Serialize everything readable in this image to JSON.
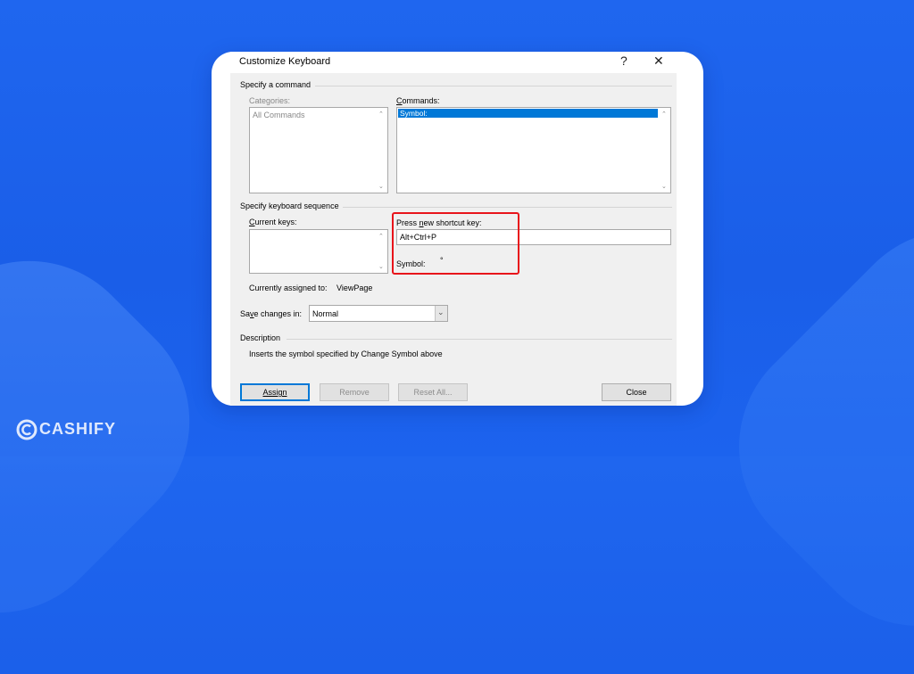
{
  "dialog": {
    "title": "Customize Keyboard",
    "help": "?",
    "close": "✕"
  },
  "specify_command": {
    "legend": "Specify a command",
    "categories_label": "Categories:",
    "categories": [
      "All Commands"
    ],
    "commands_label": "Commands:",
    "commands": [
      "Symbol:"
    ],
    "selected_command": "Symbol:"
  },
  "keyboard_sequence": {
    "legend": "Specify keyboard sequence",
    "current_keys_label": "Current keys:",
    "press_new_label": "Press new shortcut key:",
    "press_new_value": "Alt+Ctrl+P",
    "symbol_label": "Symbol:",
    "symbol_value": "°",
    "assigned_label": "Currently assigned to:",
    "assigned_value": "ViewPage"
  },
  "save_changes": {
    "label": "Save changes in:",
    "value": "Normal"
  },
  "description": {
    "legend": "Description",
    "text": "Inserts the symbol specified by Change Symbol above"
  },
  "buttons": {
    "assign": "Assign",
    "remove": "Remove",
    "reset_all": "Reset All...",
    "close": "Close"
  },
  "watermark": {
    "brand": "CASHIFY"
  },
  "colors": {
    "background": "#1f66ef",
    "selection": "#0078d7",
    "highlight": "#e8141b"
  }
}
